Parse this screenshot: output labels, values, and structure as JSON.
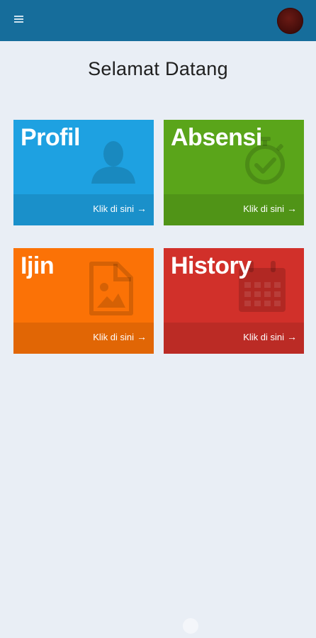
{
  "header": {
    "menu_icon": "hamburger-icon",
    "avatar_icon": "user-avatar"
  },
  "main": {
    "welcome": "Selamat Datang"
  },
  "tiles": [
    {
      "title": "Profil",
      "link": "Klik di sini",
      "icon": "person-icon",
      "color": "#1ea1e1"
    },
    {
      "title": "Absensi",
      "link": "Klik di sini",
      "icon": "stopwatch-check-icon",
      "color": "#5aa51a"
    },
    {
      "title": "Ijin",
      "link": "Klik di sini",
      "icon": "image-file-icon",
      "color": "#fb7206"
    },
    {
      "title": "History",
      "link": "Klik di sini",
      "icon": "calendar-icon",
      "color": "#d1302a"
    }
  ],
  "link_arrow": "→"
}
